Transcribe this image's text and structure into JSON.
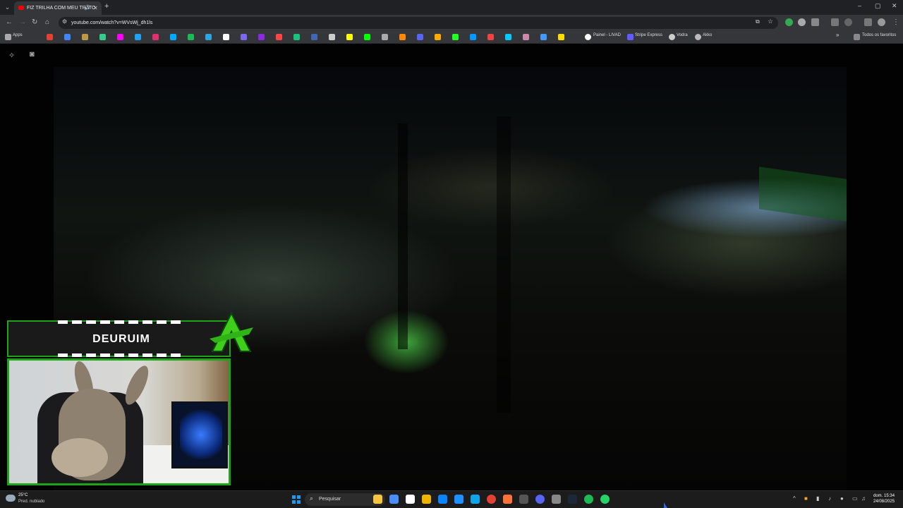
{
  "browser": {
    "tab_title": "FIZ TRILHA COM MEU TRATO",
    "new_tab_symbol": "+",
    "url": "youtube.com/watch?v=WVsWj_dh1ls",
    "window_controls": [
      "–",
      "▢",
      "✕"
    ]
  },
  "bookmarks": {
    "apps_label": "Apps",
    "items": [
      "Painel - LIVAD",
      "Stripe Express",
      "Vodra",
      "Akko"
    ],
    "all_bookmarks_label": "Todos os favoritos",
    "favicon_colors": [
      "#e34133",
      "#4285f4",
      "#b94",
      "#3c8",
      "#f0f",
      "#1da1f2",
      "#e1306c",
      "#0af",
      "#1db954",
      "#2ca5e0",
      "#fff",
      "#7b68ee",
      "#8a2be2",
      "#f44",
      "#19c37d",
      "#4267b2",
      "#ccc",
      "#ff0",
      "#0f0",
      "#aaa",
      "#f80",
      "#5865f2",
      "#fa0",
      "#2f2",
      "#09f",
      "#e44",
      "#0cf",
      "#c8a",
      "#49f",
      "#fd0"
    ]
  },
  "video": {
    "description_none": ""
  },
  "stream_overlay": {
    "streamer_name": "DEURUIM",
    "accent_color": "#1fa31a"
  },
  "taskbar": {
    "temperature": "25°C",
    "weather_text": "Pred. nublado",
    "search_placeholder": "Pesquisar",
    "time": "15:34",
    "date": "24/08/2025",
    "day": "dom.",
    "app_colors": [
      "#f5c542",
      "#4a8df8",
      "#fff",
      "#f0b400",
      "#0a84ff",
      "#1e90ff",
      "#0ea5e9",
      "#e34133",
      "#ff7139",
      "#555",
      "#5865f2",
      "#888",
      "#1b2838",
      "#1db954",
      "#25d366"
    ]
  }
}
